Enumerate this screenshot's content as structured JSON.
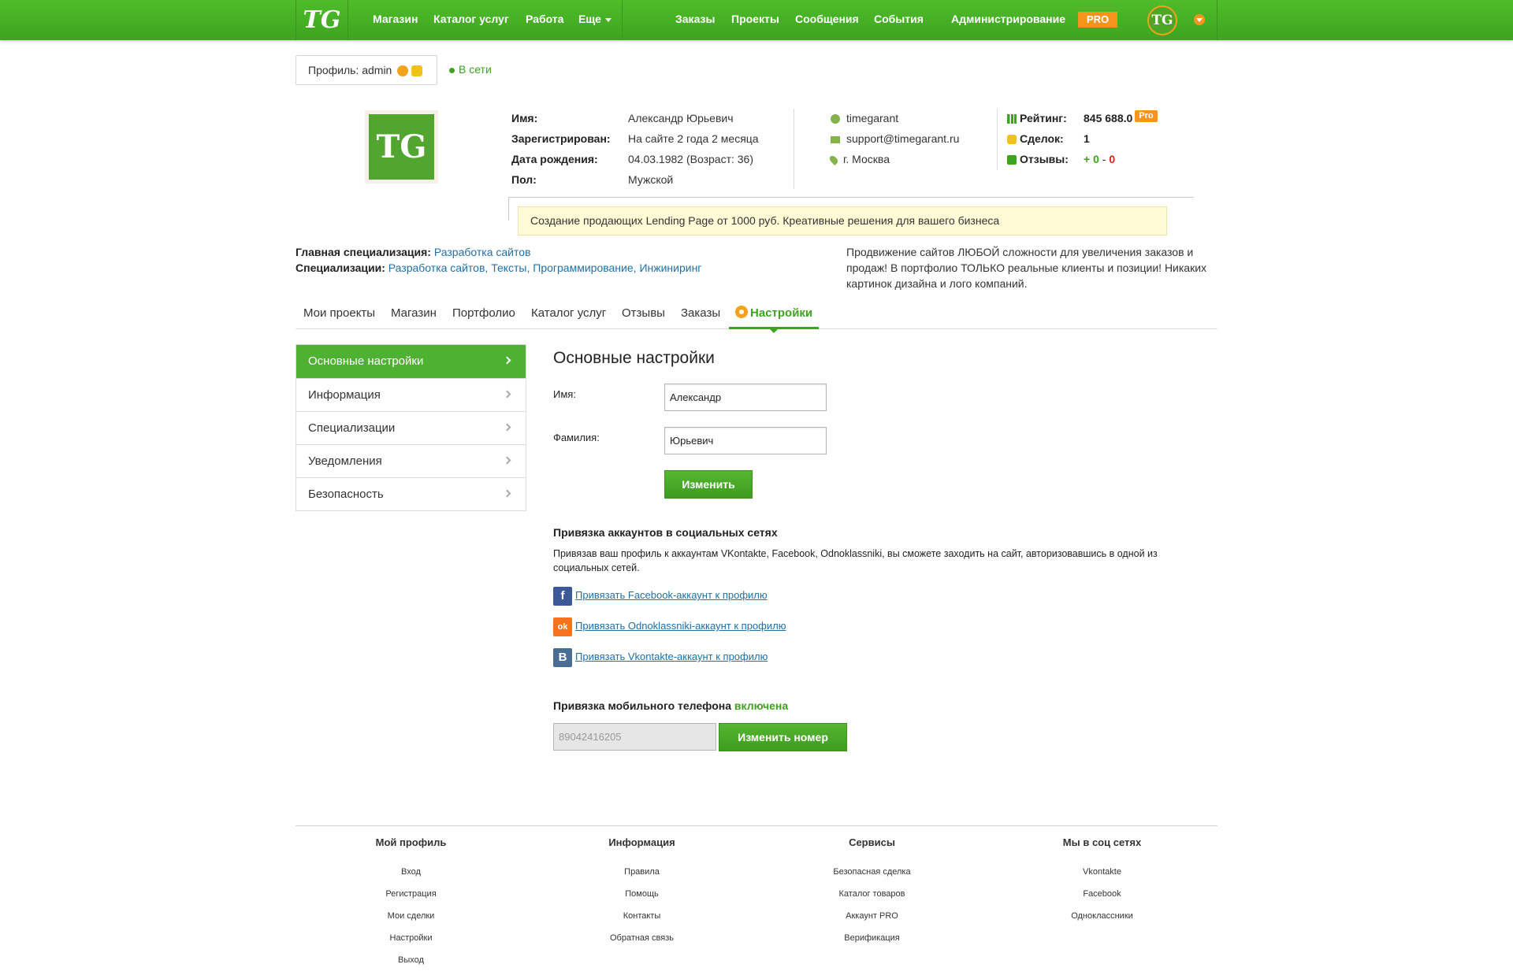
{
  "topnav": {
    "logo": "TG",
    "left_links": [
      "Магазин",
      "Каталог услуг",
      "Работа",
      "Еще"
    ],
    "right_links": [
      "Заказы",
      "Проекты",
      "Сообщения",
      "События",
      "Администрирование"
    ],
    "pro": "PRO",
    "avatar": "TG"
  },
  "profile": {
    "label": "Профиль: admin",
    "status": "В сети",
    "avatar": "TG",
    "fields": [
      {
        "label": "Имя:",
        "value": "Александр Юрьевич"
      },
      {
        "label": "Зарегистрирован:",
        "value": "На сайте 2 года 2 месяца"
      },
      {
        "label": "Дата рождения:",
        "value": "04.03.1982 (Возраст: 36)"
      },
      {
        "label": "Пол:",
        "value": "Мужской"
      }
    ],
    "contacts": {
      "skype": "timegarant",
      "email": "support@timegarant.ru",
      "city": "г. Москва"
    },
    "stats": {
      "rating_label": "Рейтинг:",
      "rating_value": "845 688.0",
      "rating_badge": "Pro",
      "deals_label": "Сделок:",
      "deals_value": "1",
      "reviews_label": "Отзывы:",
      "reviews_pos": "+ 0",
      "reviews_sep": " - ",
      "reviews_neg": "0"
    },
    "ad": "Создание продающих Lending Page от 1000 руб. Креативные решения для вашего бизнеса",
    "main_spec_label": "Главная специализация:",
    "main_spec": "Разработка сайтов",
    "specs_label": "Специализации:",
    "specs": [
      "Разработка сайтов",
      "Тексты",
      "Программирование",
      "Инжиниринг"
    ],
    "description": "Продвижение сайтов ЛЮБОЙ сложности для увеличения заказов и продаж! В портфолио ТОЛЬКО реальные клиенты и позиции! Никаких картинок дизайна и лого компаний."
  },
  "tabs": [
    "Мои проекты",
    "Магазин",
    "Портфолио",
    "Каталог услуг",
    "Отзывы",
    "Заказы",
    "Настройки"
  ],
  "sidebar": {
    "items": [
      "Основные настройки",
      "Информация",
      "Специализации",
      "Уведомления",
      "Безопасность"
    ]
  },
  "settings": {
    "title": "Основные настройки",
    "first_name_label": "Имя:",
    "first_name_value": "Александр",
    "last_name_label": "Фамилия:",
    "last_name_value": "Юрьевич",
    "save_button": "Изменить",
    "social_title": "Привязка аккаунтов в социальных сетях",
    "social_desc": "Привязав ваш профиль к аккаунтам VKontakte, Facebook, Odnoklassniki, вы сможете заходить на сайт, авторизовавшись в одной из социальных сетей.",
    "social_links": [
      {
        "icon": "facebook-icon",
        "glyph": "f",
        "color": "#3b5998",
        "text": "Привязать Facebook-аккаунт к профилю"
      },
      {
        "icon": "odnoklassniki-icon",
        "glyph": "ok",
        "color": "#f4731c",
        "text": "Привязать Odnoklassniki-аккаунт к профилю"
      },
      {
        "icon": "vkontakte-icon",
        "glyph": "B",
        "color": "#4a6d95",
        "text": "Привязать Vkontakte-аккаунт к профилю"
      }
    ],
    "mobile_title": "Привязка мобильного телефона",
    "mobile_status": "включена",
    "mobile_value": "89042416205",
    "mobile_button": "Изменить номер"
  },
  "footer": [
    {
      "title": "Мой профиль",
      "links": [
        "Вход",
        "Регистрация",
        "Мои сделки",
        "Настройки",
        "Выход"
      ]
    },
    {
      "title": "Информация",
      "links": [
        "Правила",
        "Помощь",
        "Контакты",
        "Обратная связь"
      ]
    },
    {
      "title": "Сервисы",
      "links": [
        "Безопасная сделка",
        "Каталог товаров",
        "Аккаунт PRO",
        "Верификация"
      ]
    },
    {
      "title": "Мы в соц сетях",
      "links": [
        "Vkontakte",
        "Facebook",
        "Одноклассники"
      ]
    }
  ],
  "colors": {
    "brand_green": "#3ea31f",
    "accent_orange": "#f6941d"
  }
}
